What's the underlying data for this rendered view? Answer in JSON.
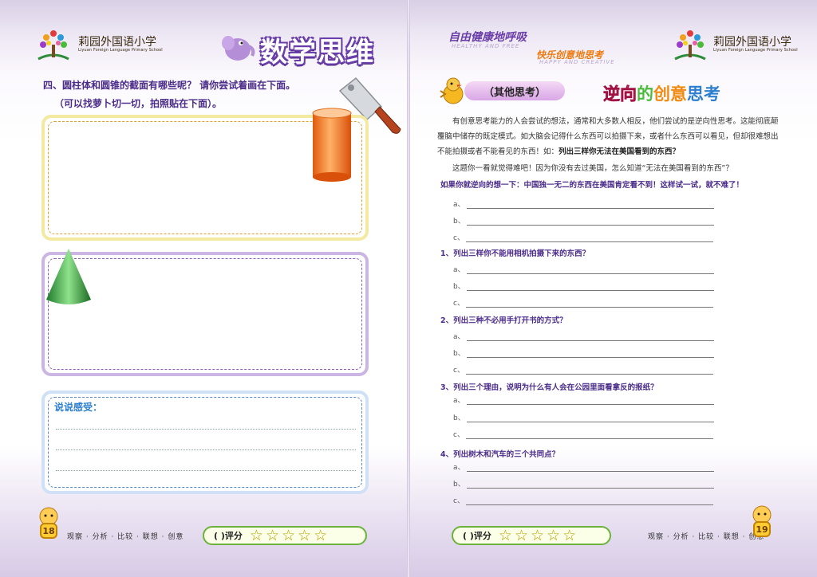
{
  "left": {
    "school_name": "莉园外国语小学",
    "school_en": "Liyuan Foreign Language Primary School",
    "title": "数学思维",
    "question_line1": "四、圆柱体和圆锥的截面有哪些呢？ 请你尝试着画在下面。",
    "question_line2": "（可以找萝卜切一切，拍照贴在下面）。",
    "feelings_label": "说说感受：",
    "page_number": "18",
    "footer_text": "观察 · 分析 · 比较 · 联想 · 创意",
    "score_paren": "(        )评分",
    "stars": [
      "☆",
      "☆",
      "☆",
      "☆",
      "☆"
    ]
  },
  "right": {
    "slogan1": "自由健康地呼吸",
    "slogan1_en": "HEALTHY AND FREE",
    "slogan2": "快乐创意地思考",
    "slogan2_en": "HAPPY AND CREATIVE",
    "school_name": "莉园外国语小学",
    "school_en": "Liyuan Foreign Language Primary School",
    "section_tag": "（其他思考）",
    "section_title_parts": [
      "逆向",
      "的",
      "创意",
      "思考"
    ],
    "para1": "有创意思考能力的人会尝试的想法，通常和大多数人相反，他们尝试的是逆向性思考。这能彻底颠覆脑中储存的既定模式。如大脑会记得什么东西可以拍摄下来，或者什么东西可以看见，但却很难想出不能拍摄或者不能看见的东西！如：",
    "para1_bold": "列出三样你无法在美国看到的东西？",
    "para2": "这题你一看就觉得难吧！因为你没有去过美国，怎么知道“无法在美国看到的东西”？",
    "para3": "如果你就逆向的想一下：中国独一无二的东西在美国肯定看不到！这样试一试，就不难了！",
    "questions": [
      "1、列出三样你不能用相机拍摄下来的东西？",
      "2、列出三种不必用手打开书的方式？",
      "3、列出三个理由，说明为什么有人会在公园里面看拿反的报纸？",
      "4、列出树木和汽车的三个共同点？"
    ],
    "answer_labels": [
      "a、",
      "b、",
      "c、"
    ],
    "page_number": "19",
    "footer_text": "观察 · 分析 · 比较 · 联想 · 创意",
    "score_paren": "(        )评分",
    "stars": [
      "☆",
      "☆",
      "☆",
      "☆",
      "☆"
    ]
  },
  "colors": {
    "purple_text": "#4b2c8a",
    "yellow_frame": "#f3e9a0",
    "yellow_dash": "#e0a030",
    "purple_frame": "#cbb5e2",
    "purple_dash": "#8c5fb8",
    "blue_frame": "#cfe0f7",
    "blue_dash": "#5f86c8",
    "score_border": "#6ab23b"
  }
}
